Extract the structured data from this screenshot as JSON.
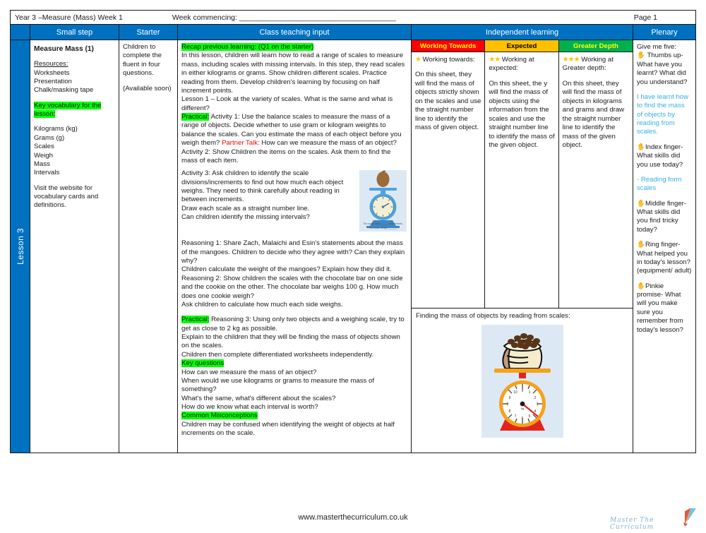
{
  "meta": {
    "title": "Year 3 –Measure (Mass)  Week 1",
    "week_commencing": "Week commencing: ______________________________________",
    "page": "Page 1"
  },
  "headers": {
    "lesson": "",
    "small_step": "Small step",
    "starter": "Starter",
    "class_teaching_input": "Class teaching input",
    "independent_learning": "Independent learning",
    "plenary": "Plenary"
  },
  "lesson_tab": "Lesson 3",
  "small_step": {
    "title": "Measure Mass (1)",
    "resources_label": "Resources:",
    "resources": [
      "Worksheets",
      "Presentation",
      "Chalk/masking tape"
    ],
    "key_vocab_heading": "Key vocabulary for the lesson:",
    "vocabulary": [
      "Kilograms (kg)",
      "Grams (g)",
      "Scales",
      "Weigh",
      "Mass",
      "Intervals"
    ],
    "note": "Visit the website for vocabulary cards and definitions."
  },
  "starter": {
    "line1": "Children to complete the fluent in four questions.",
    "line2": "(Available soon)"
  },
  "class_teaching": {
    "recap_heading": "Recap previous learning: (Q1 on the starter)",
    "intro": "In this lesson, children will learn how to read a range of scales to measure mass, including scales with missing intervals. In this step, they read scales in either kilograms or grams. Show children different scales. Practice reading from them. Develop children's learning by focusing on half increment points.",
    "lesson1": "Lesson 1 – Look at the variety of scales. What is the same and what is different?",
    "practical_label1": "Practical:",
    "activity1": " Activity 1:  Use the balance scales to measure the mass of a range of objects. Decide whether to use gram or kilogram weights to balance the scales. Can you estimate the mass of each object before you weigh them? ",
    "partner_talk_label": "Partner Talk:",
    "partner_talk": " How can we measure the mass of an object?",
    "activity2": "Activity 2: Show Children the items on the scales. Ask them to find the mass of each item.",
    "activity3": "Activity 3: Ask children to identify the scale divisions/increments to find out how much each object weighs. They need to think carefully about reading in between increments.",
    "activity3b": " Draw each scale as a straight number line.",
    "activity3c": " Can children identify the missing intervals?",
    "reasoning1": "Reasoning 1: Share Zach, Malaichi and Esin's statements about the mass of the mangoes.  Children to decide who they agree with? Can they explain why?",
    "reasoning1b": "Children calculate the weight of the mangoes? Explain how they did it.",
    "reasoning2": "Reasoning 2: Show children the scales with the chocolate bar on one side and the cookie on the other.  The chocolate bar weighs 100 g.  How much does one cookie weigh?",
    "reasoning2b": "Ask children to calculate how much each side weighs.",
    "practical_label2": "Practical:",
    "reasoning3": " Reasoning 3: Using only two objects and a weighing scale, try to get as close to 2 kg as possible.",
    "explain": "Explain to the children that they will be finding the mass of objects shown on the scales.",
    "worksheets_line": "Children then complete differentiated worksheets independently.",
    "key_questions_heading": "Key questions",
    "key_questions": [
      "How can we measure the mass of an object?",
      "When would we use kilograms or grams to measure the mass of something?",
      "What's the same, what's different about the scales?",
      "How do we know what each interval is worth?"
    ],
    "misconceptions_heading": "Common Misconceptions",
    "misconceptions": "Children may be confused when identifying the weight of objects at half increments on the scale.",
    "mini_figure_caption1": "The scale uses ______ increments.",
    "mini_figure_caption2": "The onion weigh ______."
  },
  "independent_learning": {
    "columns": [
      {
        "band": "Working Towards",
        "stars": "★",
        "subtitle": " Working towards:",
        "body": "On this sheet, they will find the mass of objects strictly shown on the scales and use the straight number line to identify the mass of given object."
      },
      {
        "band": "Expected",
        "stars": "★★",
        "subtitle": " Working at expected:",
        "body": "On this sheet, the y will find the mass of objects using the information from the scales and use the straight number line to identify the mass of the given object."
      },
      {
        "band": "Greater Depth",
        "stars": "★★★",
        "subtitle": " Working at Greater depth:",
        "body": "On this sheet, they will find the mass of objects in kilograms and grams and draw the straight number line to identify the mass of the given object."
      }
    ],
    "figure_caption": "Finding the mass of objects by reading from scales:"
  },
  "plenary": {
    "intro": "Give me five:",
    "items": [
      {
        "icon": "hand-icon",
        "text": " Thumbs up- What have you learnt? What did you understand?",
        "answer": "I have learnt how to find the mass of objects by reading from scales."
      },
      {
        "icon": "hand-icon",
        "text": "Index finger- What skills did you use today?",
        "answer": "- Reading form scales"
      },
      {
        "icon": "hand-icon",
        "text": "Middle finger- What skills did you find tricky today?",
        "answer": ""
      },
      {
        "icon": "hand-icon",
        "text": "Ring finger- What helped you in today's lesson? (equipment/ adult)",
        "answer": ""
      },
      {
        "icon": "hand-icon",
        "text": "Pinkie promise- What will you make sure you remember from today's lesson?",
        "answer": ""
      }
    ]
  },
  "footer": {
    "url": "www.masterthecurriculum.co.uk",
    "brand": "Master  The  Curriculum"
  },
  "colors": {
    "header_blue": "#0070c0",
    "highlight_green": "#00ff00",
    "working_towards": "#ff0000",
    "expected": "#ffc000",
    "greater_depth": "#00b050",
    "plenary_answer_blue": "#33b1e8"
  }
}
